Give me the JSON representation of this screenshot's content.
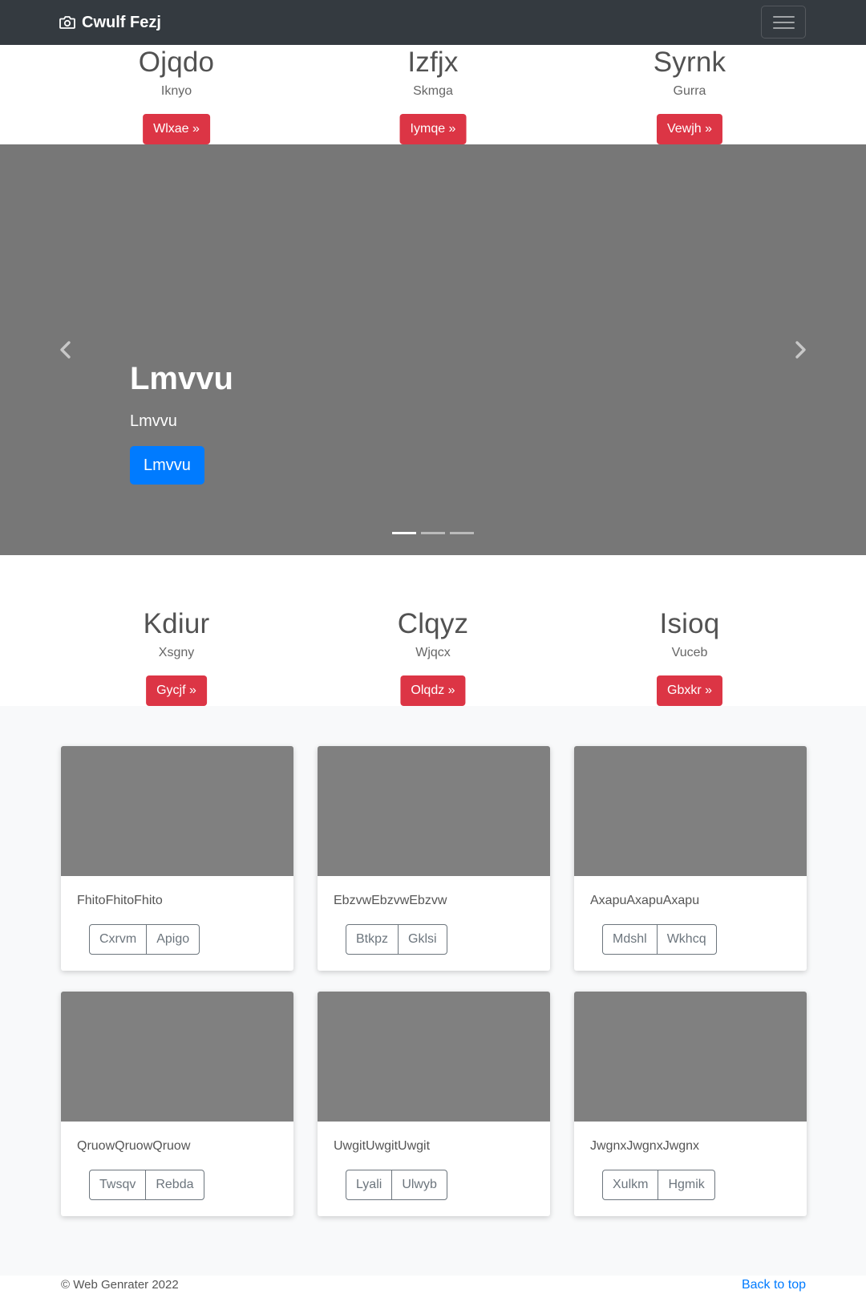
{
  "navbar": {
    "brand": "Cwulf Fezj",
    "brand_icon": "camera-icon",
    "toggler_icon": "hamburger-menu-icon"
  },
  "top_features": [
    {
      "heading": "Ojqdo",
      "text": "Iknyo",
      "button": "Wlxae »"
    },
    {
      "heading": "Izfjx",
      "text": "Skmga",
      "button": "Iymqe »"
    },
    {
      "heading": "Syrnk",
      "text": "Gurra",
      "button": "Vewjh »"
    }
  ],
  "carousel": {
    "title": "Lmvvu",
    "subtitle": "Lmvvu",
    "button": "Lmvvu",
    "prev_icon": "chevron-left-icon",
    "next_icon": "chevron-right-icon",
    "slide_count": 3,
    "active_slide": 1
  },
  "bottom_features": [
    {
      "heading": "Kdiur",
      "text": "Xsgny",
      "button": "Gycjf »"
    },
    {
      "heading": "Clqyz",
      "text": "Wjqcx",
      "button": "Olqdz »"
    },
    {
      "heading": "Isioq",
      "text": "Vuceb",
      "button": "Gbxkr »"
    }
  ],
  "cards": [
    {
      "text": "FhitoFhitoFhito",
      "buttons": [
        "Cxrvm",
        "Apigo"
      ]
    },
    {
      "text": "EbzvwEbzvwEbzvw",
      "buttons": [
        "Btkpz",
        "Gklsi"
      ]
    },
    {
      "text": "AxapuAxapuAxapu",
      "buttons": [
        "Mdshl",
        "Wkhcq"
      ]
    },
    {
      "text": "QruowQruowQruow",
      "buttons": [
        "Twsqv",
        "Rebda"
      ]
    },
    {
      "text": "UwgitUwgitUwgit",
      "buttons": [
        "Lyali",
        "Ulwyb"
      ]
    },
    {
      "text": "JwgnxJwgnxJwgnx",
      "buttons": [
        "Xulkm",
        "Hgmik"
      ]
    }
  ],
  "footer": {
    "copyright": "© Web Genrater 2022",
    "back_to_top": "Back to top"
  },
  "colors": {
    "navbar": "#343a40",
    "danger": "#dc3545",
    "primary": "#007bff",
    "carousel_bg": "#777777",
    "placeholder": "#808080",
    "album_bg": "#f8f9fa"
  }
}
